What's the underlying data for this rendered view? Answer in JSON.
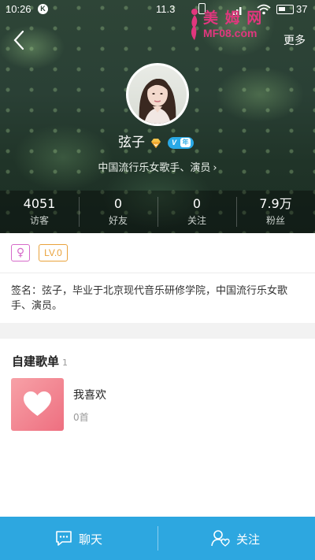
{
  "status_bar": {
    "time": "10:26",
    "k_badge": "K",
    "speed": "11.3",
    "battery": "37"
  },
  "watermark": {
    "title": "美 姆 网",
    "url": "MF08.com"
  },
  "nav": {
    "more_label": "更多"
  },
  "profile": {
    "name": "弦子",
    "description": "中国流行乐女歌手、演员",
    "badge_v_letter": "V",
    "badge_year": "年"
  },
  "stats": [
    {
      "value": "4051",
      "label": "访客"
    },
    {
      "value": "0",
      "label": "好友"
    },
    {
      "value": "0",
      "label": "关注"
    },
    {
      "value": "7.9万",
      "label": "粉丝"
    }
  ],
  "info": {
    "gender_symbol": "♀",
    "level": "LV.0",
    "signature": "签名：弦子，毕业于北京现代音乐研修学院，中国流行乐女歌手、演员。"
  },
  "playlists": {
    "title": "自建歌单",
    "count": "1",
    "items": [
      {
        "name": "我喜欢",
        "count": "0首"
      }
    ]
  },
  "bottom_bar": {
    "chat_label": "聊天",
    "follow_label": "关注"
  },
  "colors": {
    "accent": "#2da7e0",
    "gender": "#d66ac9",
    "level": "#e9a23b",
    "cover": "#ee6f80",
    "watermark": "#e0377e"
  }
}
